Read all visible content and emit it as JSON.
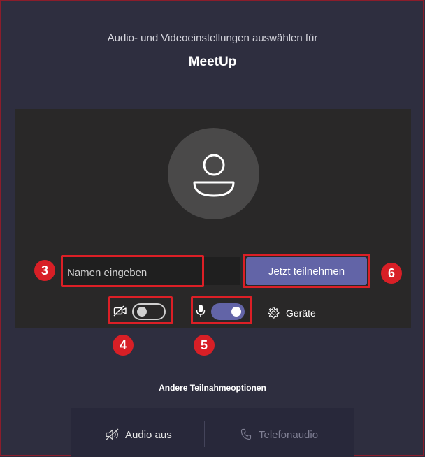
{
  "header": {
    "subtitle": "Audio- und Videoeinstellungen auswählen für",
    "meeting_title": "MeetUp"
  },
  "join": {
    "name_placeholder": "Namen eingeben",
    "join_button_label": "Jetzt teilnehmen"
  },
  "controls": {
    "camera_on": false,
    "microphone_on": true,
    "devices_label": "Geräte"
  },
  "annotations": [
    "3",
    "4",
    "5",
    "6"
  ],
  "other_options": {
    "heading": "Andere Teilnahmeoptionen",
    "audio_off_label": "Audio aus",
    "phone_audio_label": "Telefonaudio"
  },
  "colors": {
    "background": "#2e2e3f",
    "preview": "#292828",
    "accent": "#6264a7",
    "annotation_red": "#dc1f26"
  }
}
